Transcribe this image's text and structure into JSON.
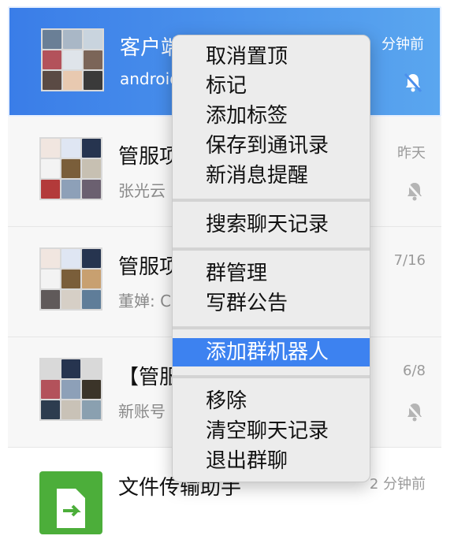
{
  "chats": [
    {
      "title": "客户端问题讨论",
      "sub": "android...",
      "time": "分钟前",
      "muted": true
    },
    {
      "title": "管服项目群",
      "sub": "张光云",
      "time": "昨天",
      "muted": true
    },
    {
      "title": "管服项目群",
      "sub": "董婵: C",
      "time": "7/16",
      "muted": false
    },
    {
      "title": "【管服",
      "sub": "新账号",
      "time": "6/8",
      "muted": true
    },
    {
      "title": "文件传输助手",
      "sub": "",
      "time": "2 分钟前",
      "muted": false
    }
  ],
  "menu": {
    "items": [
      {
        "label": "取消置顶"
      },
      {
        "label": "标记"
      },
      {
        "label": "添加标签"
      },
      {
        "label": "保存到通讯录"
      },
      {
        "label": "新消息提醒"
      },
      {
        "label": "搜索聊天记录"
      },
      {
        "label": "群管理"
      },
      {
        "label": "写群公告"
      },
      {
        "label": "添加群机器人"
      },
      {
        "label": "移除"
      },
      {
        "label": "清空聊天记录"
      },
      {
        "label": "退出群聊"
      }
    ],
    "highlighted_index": 8
  },
  "colors": {
    "accent": "#3d82f0",
    "file_helper": "#4cae3a"
  },
  "icons": {
    "muted": "bell-muted-icon",
    "file": "file-transfer-icon"
  }
}
